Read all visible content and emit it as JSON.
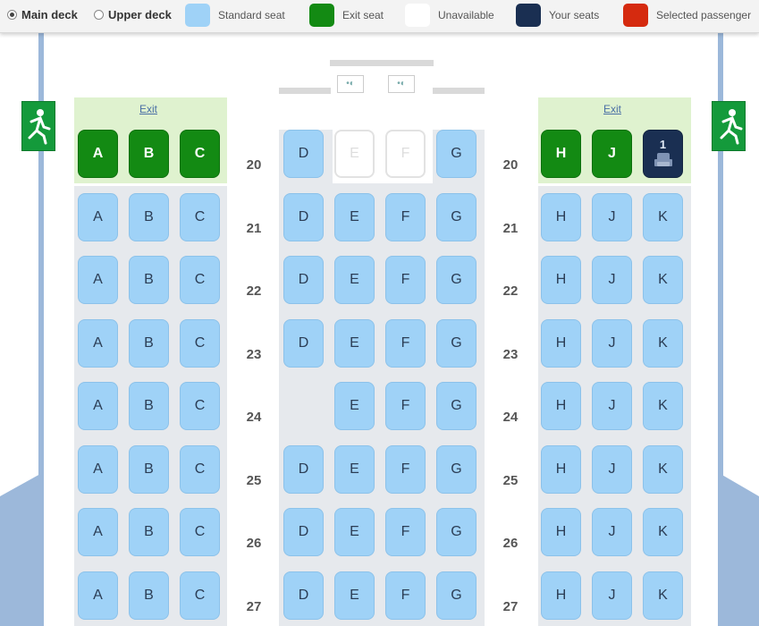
{
  "legend": {
    "decks": [
      {
        "label": "Main deck",
        "selected": true
      },
      {
        "label": "Upper deck",
        "selected": false
      }
    ],
    "items": [
      {
        "key": "standard",
        "label": "Standard seat",
        "color": "#9fd2f7"
      },
      {
        "key": "exit",
        "label": "Exit seat",
        "color": "#138a13"
      },
      {
        "key": "unavailable",
        "label": "Unavailable",
        "color": "#ffffff"
      },
      {
        "key": "your",
        "label": "Your seats",
        "color": "#1a2f52"
      },
      {
        "key": "selected",
        "label": "Selected passenger",
        "color": "#d52a0f"
      }
    ]
  },
  "cabin": {
    "exit_label": "Exit",
    "rows": [
      {
        "number": "20",
        "left": [
          {
            "letter": "A",
            "type": "exit"
          },
          {
            "letter": "B",
            "type": "exit"
          },
          {
            "letter": "C",
            "type": "exit"
          }
        ],
        "middle": [
          {
            "letter": "D",
            "type": "standard"
          },
          {
            "letter": "E",
            "type": "unavailable"
          },
          {
            "letter": "F",
            "type": "unavailable"
          },
          {
            "letter": "G",
            "type": "standard"
          }
        ],
        "right": [
          {
            "letter": "H",
            "type": "exit"
          },
          {
            "letter": "J",
            "type": "exit"
          },
          {
            "letter": "K",
            "type": "your",
            "passenger": "1"
          }
        ]
      },
      {
        "number": "21",
        "left": [
          {
            "letter": "A",
            "type": "standard"
          },
          {
            "letter": "B",
            "type": "standard"
          },
          {
            "letter": "C",
            "type": "standard"
          }
        ],
        "middle": [
          {
            "letter": "D",
            "type": "standard"
          },
          {
            "letter": "E",
            "type": "standard"
          },
          {
            "letter": "F",
            "type": "standard"
          },
          {
            "letter": "G",
            "type": "standard"
          }
        ],
        "right": [
          {
            "letter": "H",
            "type": "standard"
          },
          {
            "letter": "J",
            "type": "standard"
          },
          {
            "letter": "K",
            "type": "standard"
          }
        ]
      },
      {
        "number": "22",
        "left": [
          {
            "letter": "A",
            "type": "standard"
          },
          {
            "letter": "B",
            "type": "standard"
          },
          {
            "letter": "C",
            "type": "standard"
          }
        ],
        "middle": [
          {
            "letter": "D",
            "type": "standard"
          },
          {
            "letter": "E",
            "type": "standard"
          },
          {
            "letter": "F",
            "type": "standard"
          },
          {
            "letter": "G",
            "type": "standard"
          }
        ],
        "right": [
          {
            "letter": "H",
            "type": "standard"
          },
          {
            "letter": "J",
            "type": "standard"
          },
          {
            "letter": "K",
            "type": "standard"
          }
        ]
      },
      {
        "number": "23",
        "left": [
          {
            "letter": "A",
            "type": "standard"
          },
          {
            "letter": "B",
            "type": "standard"
          },
          {
            "letter": "C",
            "type": "standard"
          }
        ],
        "middle": [
          {
            "letter": "D",
            "type": "standard"
          },
          {
            "letter": "E",
            "type": "standard"
          },
          {
            "letter": "F",
            "type": "standard"
          },
          {
            "letter": "G",
            "type": "standard"
          }
        ],
        "right": [
          {
            "letter": "H",
            "type": "standard"
          },
          {
            "letter": "J",
            "type": "standard"
          },
          {
            "letter": "K",
            "type": "standard"
          }
        ]
      },
      {
        "number": "24",
        "left": [
          {
            "letter": "A",
            "type": "standard"
          },
          {
            "letter": "B",
            "type": "standard"
          },
          {
            "letter": "C",
            "type": "standard"
          }
        ],
        "middle": [
          null,
          {
            "letter": "E",
            "type": "standard"
          },
          {
            "letter": "F",
            "type": "standard"
          },
          {
            "letter": "G",
            "type": "standard"
          }
        ],
        "right": [
          {
            "letter": "H",
            "type": "standard"
          },
          {
            "letter": "J",
            "type": "standard"
          },
          {
            "letter": "K",
            "type": "standard"
          }
        ]
      },
      {
        "number": "25",
        "left": [
          {
            "letter": "A",
            "type": "standard"
          },
          {
            "letter": "B",
            "type": "standard"
          },
          {
            "letter": "C",
            "type": "standard"
          }
        ],
        "middle": [
          {
            "letter": "D",
            "type": "standard"
          },
          {
            "letter": "E",
            "type": "standard"
          },
          {
            "letter": "F",
            "type": "standard"
          },
          {
            "letter": "G",
            "type": "standard"
          }
        ],
        "right": [
          {
            "letter": "H",
            "type": "standard"
          },
          {
            "letter": "J",
            "type": "standard"
          },
          {
            "letter": "K",
            "type": "standard"
          }
        ]
      },
      {
        "number": "26",
        "left": [
          {
            "letter": "A",
            "type": "standard"
          },
          {
            "letter": "B",
            "type": "standard"
          },
          {
            "letter": "C",
            "type": "standard"
          }
        ],
        "middle": [
          {
            "letter": "D",
            "type": "standard"
          },
          {
            "letter": "E",
            "type": "standard"
          },
          {
            "letter": "F",
            "type": "standard"
          },
          {
            "letter": "G",
            "type": "standard"
          }
        ],
        "right": [
          {
            "letter": "H",
            "type": "standard"
          },
          {
            "letter": "J",
            "type": "standard"
          },
          {
            "letter": "K",
            "type": "standard"
          }
        ]
      },
      {
        "number": "27",
        "left": [
          {
            "letter": "A",
            "type": "standard"
          },
          {
            "letter": "B",
            "type": "standard"
          },
          {
            "letter": "C",
            "type": "standard"
          }
        ],
        "middle": [
          {
            "letter": "D",
            "type": "standard"
          },
          {
            "letter": "E",
            "type": "standard"
          },
          {
            "letter": "F",
            "type": "standard"
          },
          {
            "letter": "G",
            "type": "standard"
          }
        ],
        "right": [
          {
            "letter": "H",
            "type": "standard"
          },
          {
            "letter": "J",
            "type": "standard"
          },
          {
            "letter": "K",
            "type": "standard"
          }
        ]
      }
    ]
  }
}
